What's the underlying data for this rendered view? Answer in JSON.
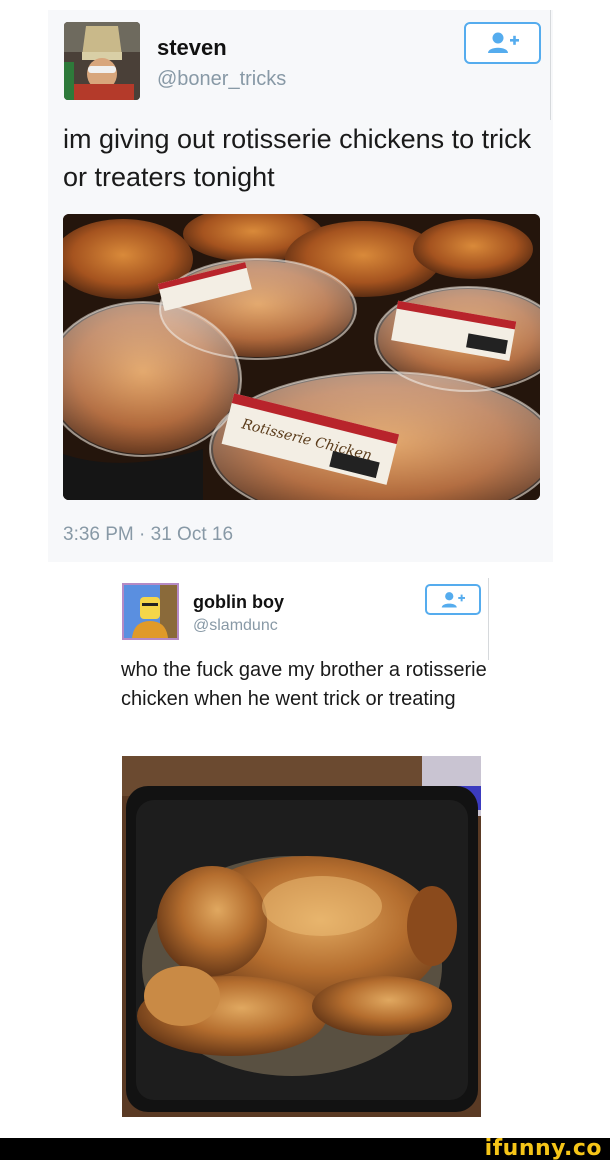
{
  "tweet1": {
    "name": "steven",
    "handle": "@boner_tricks",
    "text": "im giving out rotisserie chickens to trick or treaters tonight",
    "timestamp": "3:36 PM · 31 Oct 16",
    "follow_icon": "add-user-icon",
    "photo_label_text": "Rotisserie Chicken"
  },
  "tweet2": {
    "name": "goblin boy",
    "handle": "@slamdunc",
    "text": "who the fuck gave my brother a rotisserie chicken when he went trick or treating",
    "follow_icon": "add-user-icon"
  },
  "footer": {
    "brand": "ifunny.co"
  },
  "colors": {
    "accent": "#55acee",
    "muted": "#8899a6",
    "brand": "#f5c518"
  }
}
